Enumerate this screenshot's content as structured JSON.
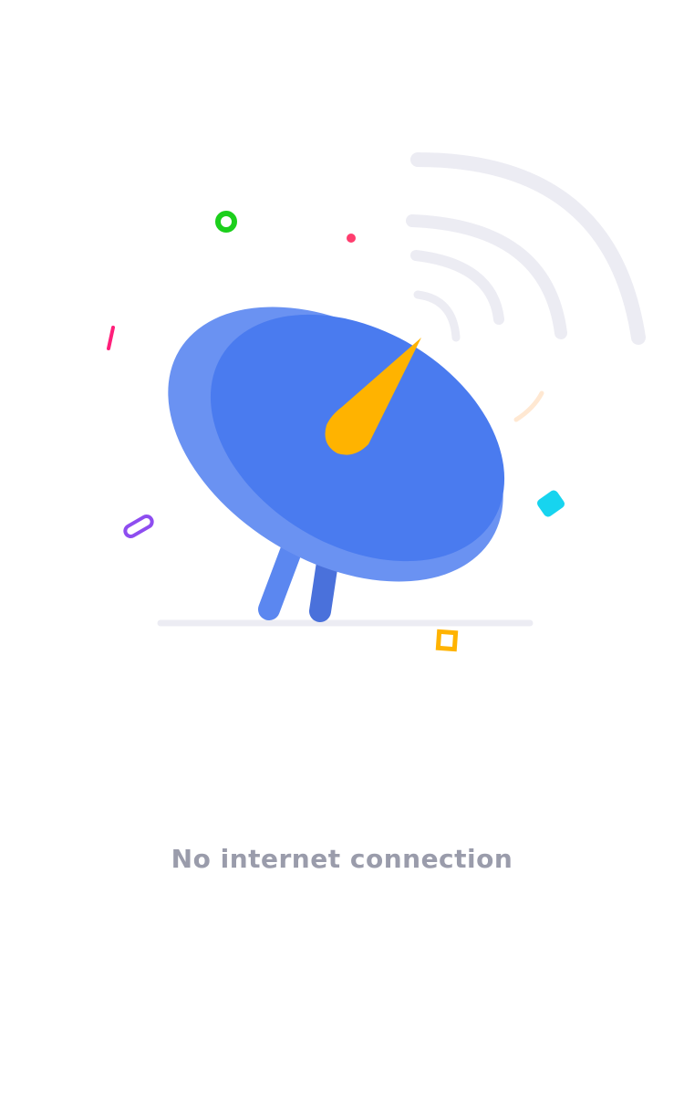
{
  "empty_state": {
    "illustration": {
      "icon": "satellite-dish-icon",
      "colors": {
        "dish": "#4a7bef",
        "dish_rim": "#6a92f2",
        "legs_front": "#5b87f0",
        "legs_back": "#4a71db",
        "feed_horn": "#ffb300",
        "signal_waves": "#ececf3",
        "ground_line": "#ececf3"
      }
    },
    "message": "No internet connection"
  }
}
